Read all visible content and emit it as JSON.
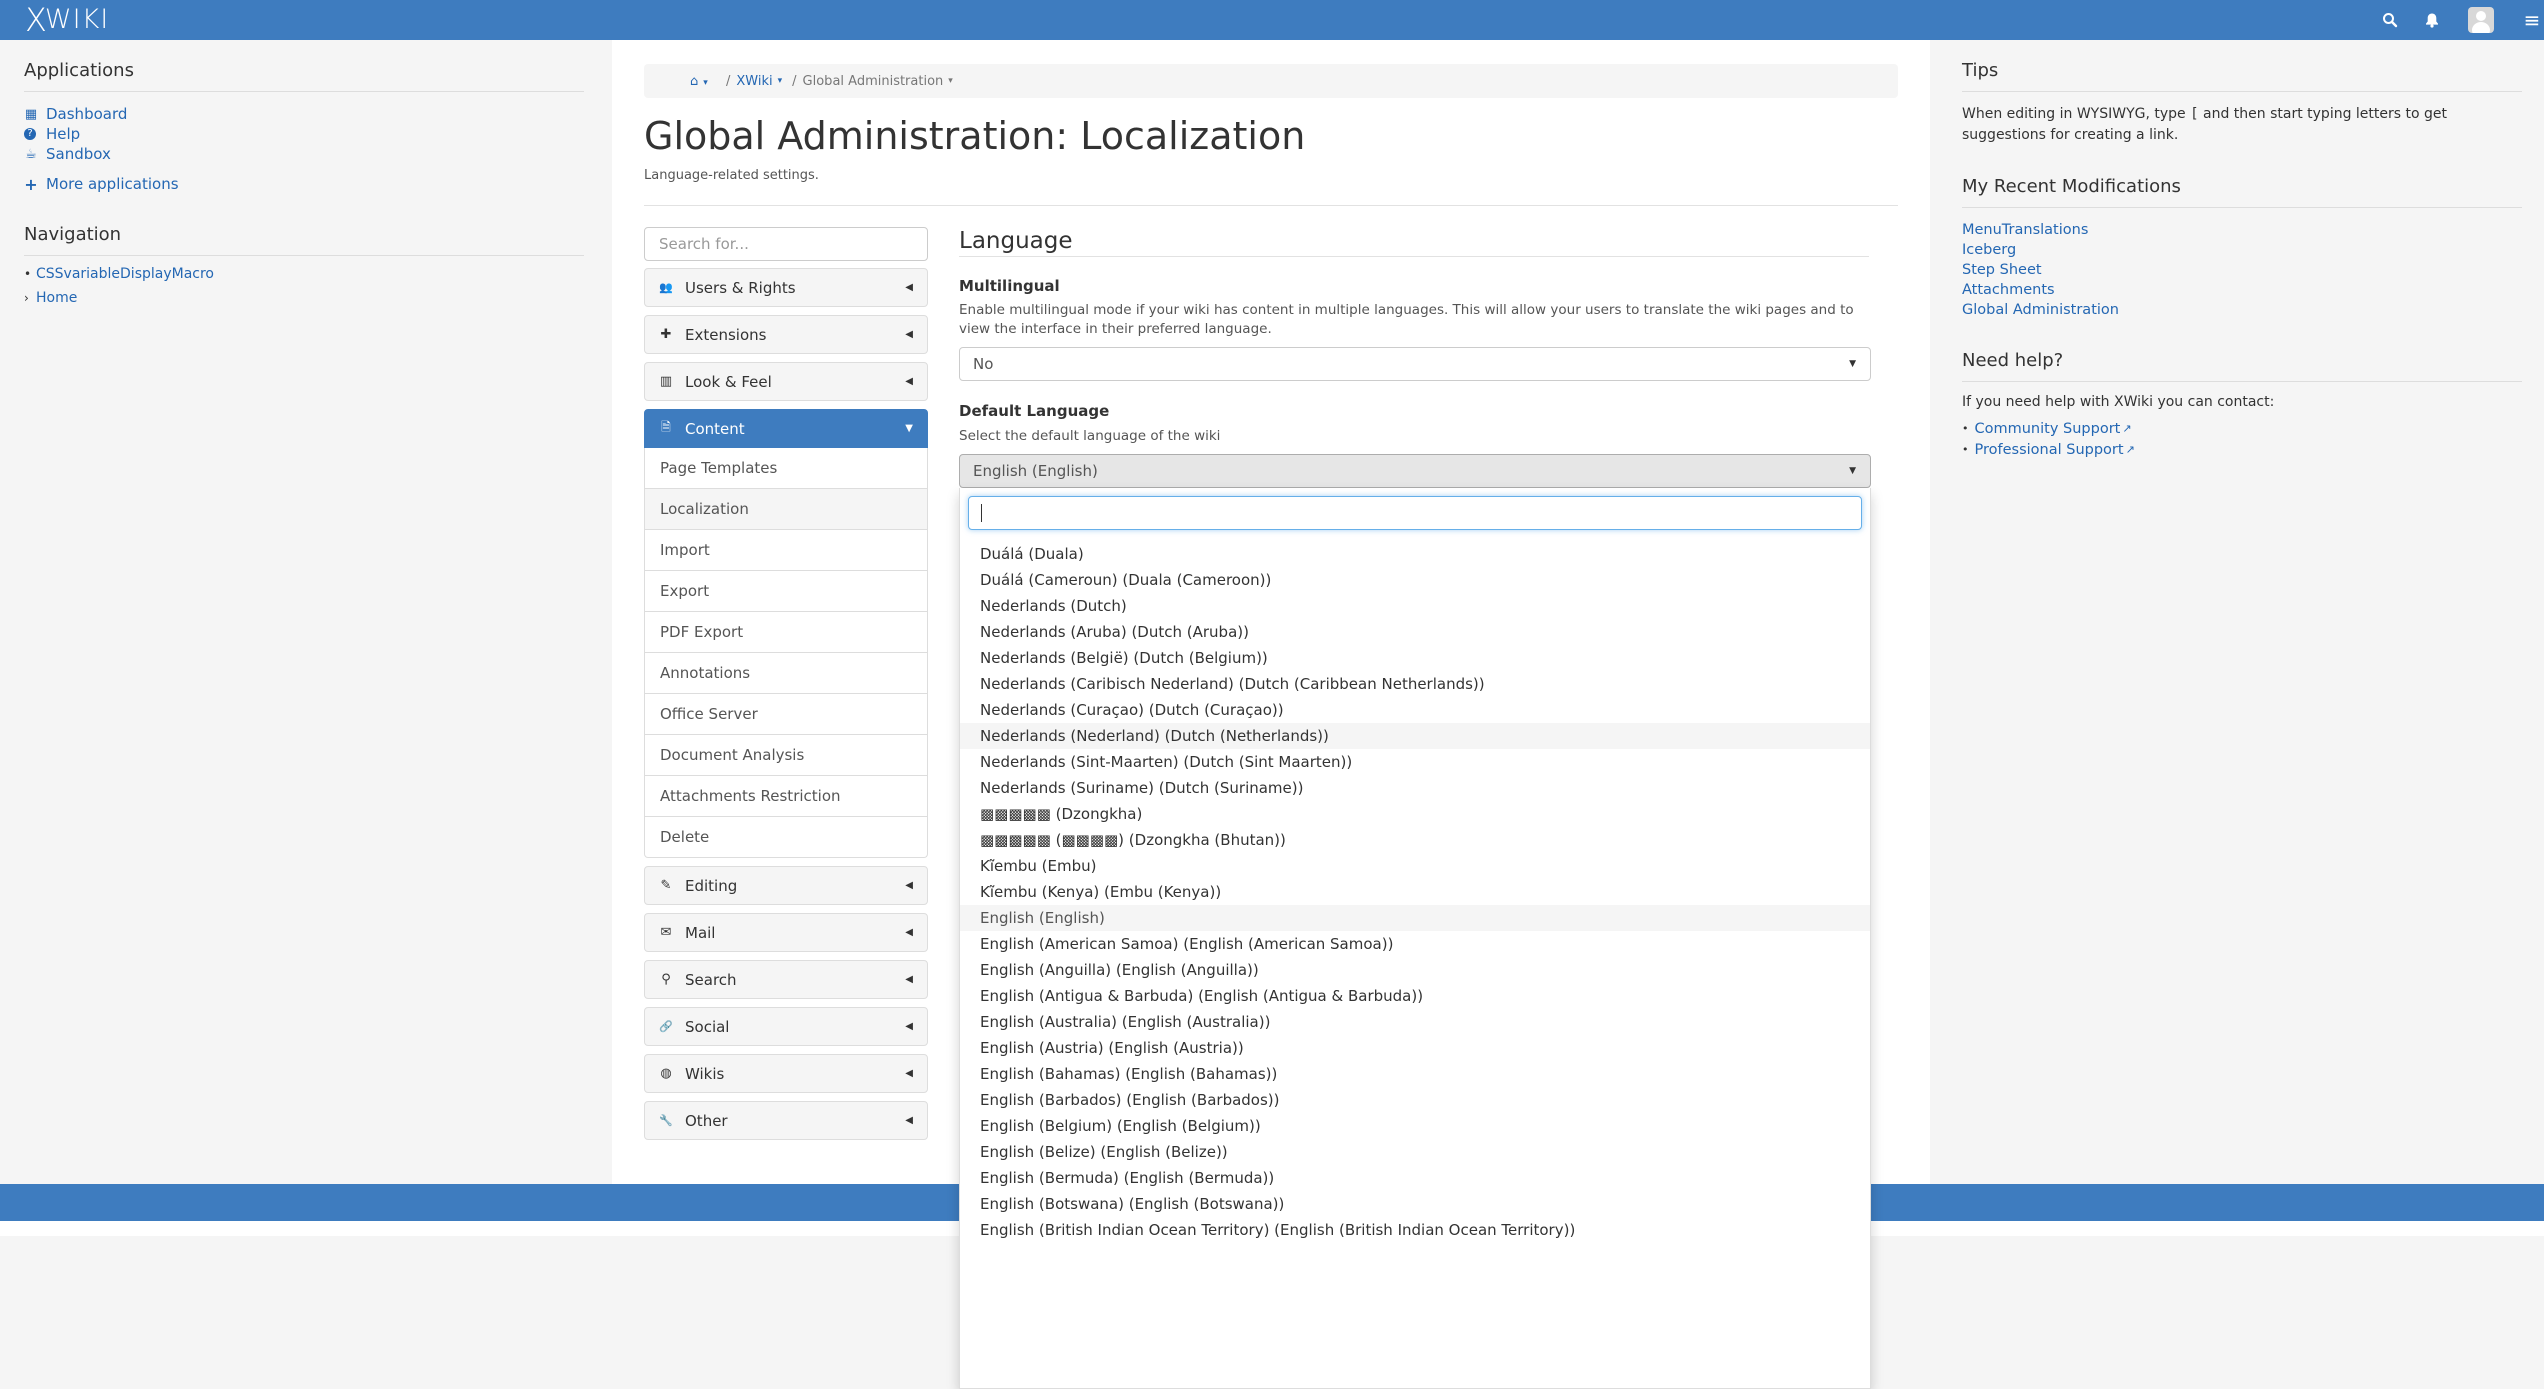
{
  "topbar": {
    "logo_x": "X",
    "logo_text": "WIKI",
    "search_icon": "search-icon",
    "bell_icon": "bell-icon",
    "menu_glyph": "≡",
    "brand_color": "#3e7cbf"
  },
  "left": {
    "applications_title": "Applications",
    "apps": [
      {
        "icon": "dashboard-icon",
        "glyph": "▦",
        "label": "Dashboard"
      },
      {
        "icon": "help-icon",
        "glyph": "?",
        "label": "Help"
      },
      {
        "icon": "sandbox-icon",
        "glyph": "☕",
        "label": "Sandbox"
      },
      {
        "icon": "plus-icon",
        "glyph": "+",
        "label": "More applications"
      }
    ],
    "navigation_title": "Navigation",
    "nav": [
      {
        "bullet": "•",
        "label": "CSSvariableDisplayMacro"
      },
      {
        "bullet": "›",
        "label": "Home"
      }
    ]
  },
  "breadcrumb": {
    "home_glyph": "⌂",
    "caret": "▾",
    "xwiki": "XWiki",
    "current": "Global Administration",
    "sep": "/"
  },
  "page": {
    "title": "Global Administration: Localization",
    "description": "Language-related settings."
  },
  "admin_menu": {
    "search_placeholder": "Search for...",
    "categories": [
      {
        "label": "Users & Rights",
        "icon": "users-icon",
        "glyph": "👥"
      },
      {
        "label": "Extensions",
        "icon": "puzzle-icon",
        "glyph": "✚"
      },
      {
        "label": "Look & Feel",
        "icon": "layout-icon",
        "glyph": "▥"
      },
      {
        "label": "Content",
        "icon": "file-icon",
        "glyph": "🗎"
      },
      {
        "label": "Editing",
        "icon": "pencil-icon",
        "glyph": "✎"
      },
      {
        "label": "Mail",
        "icon": "envelope-icon",
        "glyph": "✉"
      },
      {
        "label": "Search",
        "icon": "search-icon",
        "glyph": "⚲"
      },
      {
        "label": "Social",
        "icon": "link-icon",
        "glyph": "🔗"
      },
      {
        "label": "Wikis",
        "icon": "globe-icon",
        "glyph": "◍"
      },
      {
        "label": "Other",
        "icon": "wrench-icon",
        "glyph": "🔧"
      }
    ],
    "content_items": [
      "Page Templates",
      "Localization",
      "Import",
      "Export",
      "PDF Export",
      "Annotations",
      "Office Server",
      "Document Analysis",
      "Attachments Restriction",
      "Delete"
    ],
    "triangle_left": "◀",
    "triangle_down": "▼"
  },
  "language": {
    "section_title": "Language",
    "multilingual_label": "Multilingual",
    "multilingual_hint": "Enable multilingual mode if your wiki has content in multiple languages. This will allow your users to translate the wiki pages and to view the interface in their preferred language.",
    "multilingual_value": "No",
    "default_label": "Default Language",
    "default_hint": "Select the default language of the wiki",
    "default_value": "English (English)",
    "caret": "▼"
  },
  "dropdown": {
    "search_value": "",
    "options": [
      "Duálá (Duala)",
      "Duálá (Cameroun) (Duala (Cameroon))",
      "Nederlands (Dutch)",
      "Nederlands (Aruba) (Dutch (Aruba))",
      "Nederlands (België) (Dutch (Belgium))",
      "Nederlands (Caribisch Nederland) (Dutch (Caribbean Netherlands))",
      "Nederlands (Curaçao) (Dutch (Curaçao))",
      "Nederlands (Nederland) (Dutch (Netherlands))",
      "Nederlands (Sint-Maarten) (Dutch (Sint Maarten))",
      "Nederlands (Suriname) (Dutch (Suriname))",
      "▩▩▩▩▩ (Dzongkha)",
      "▩▩▩▩▩ (▩▩▩▩) (Dzongkha (Bhutan))",
      "Kĩembu (Embu)",
      "Kĩembu (Kenya) (Embu (Kenya))",
      "English (English)",
      "English (American Samoa) (English (American Samoa))",
      "English (Anguilla) (English (Anguilla))",
      "English (Antigua & Barbuda) (English (Antigua & Barbuda))",
      "English (Australia) (English (Australia))",
      "English (Austria) (English (Austria))",
      "English (Bahamas) (English (Bahamas))",
      "English (Barbados) (English (Barbados))",
      "English (Belgium) (English (Belgium))",
      "English (Belize) (English (Belize))",
      "English (Bermuda) (English (Bermuda))",
      "English (Botswana) (English (Botswana))",
      "English (British Indian Ocean Territory) (English (British Indian Ocean Territory))"
    ]
  },
  "right": {
    "tips_title": "Tips",
    "tips_before": "When editing in WYSIWYG, type ",
    "tips_code": "[",
    "tips_after": " and then start typing letters to get suggestions for creating a link.",
    "mods_title": "My Recent Modifications",
    "mods": [
      "MenuTranslations",
      "Iceberg",
      "Step Sheet",
      "Attachments",
      "Global Administration"
    ],
    "help_title": "Need help?",
    "help_text": "If you need help with XWiki you can contact:",
    "help_links": [
      "Community Support",
      "Professional Support"
    ],
    "ext_glyph": "↗",
    "bullet": "•"
  }
}
